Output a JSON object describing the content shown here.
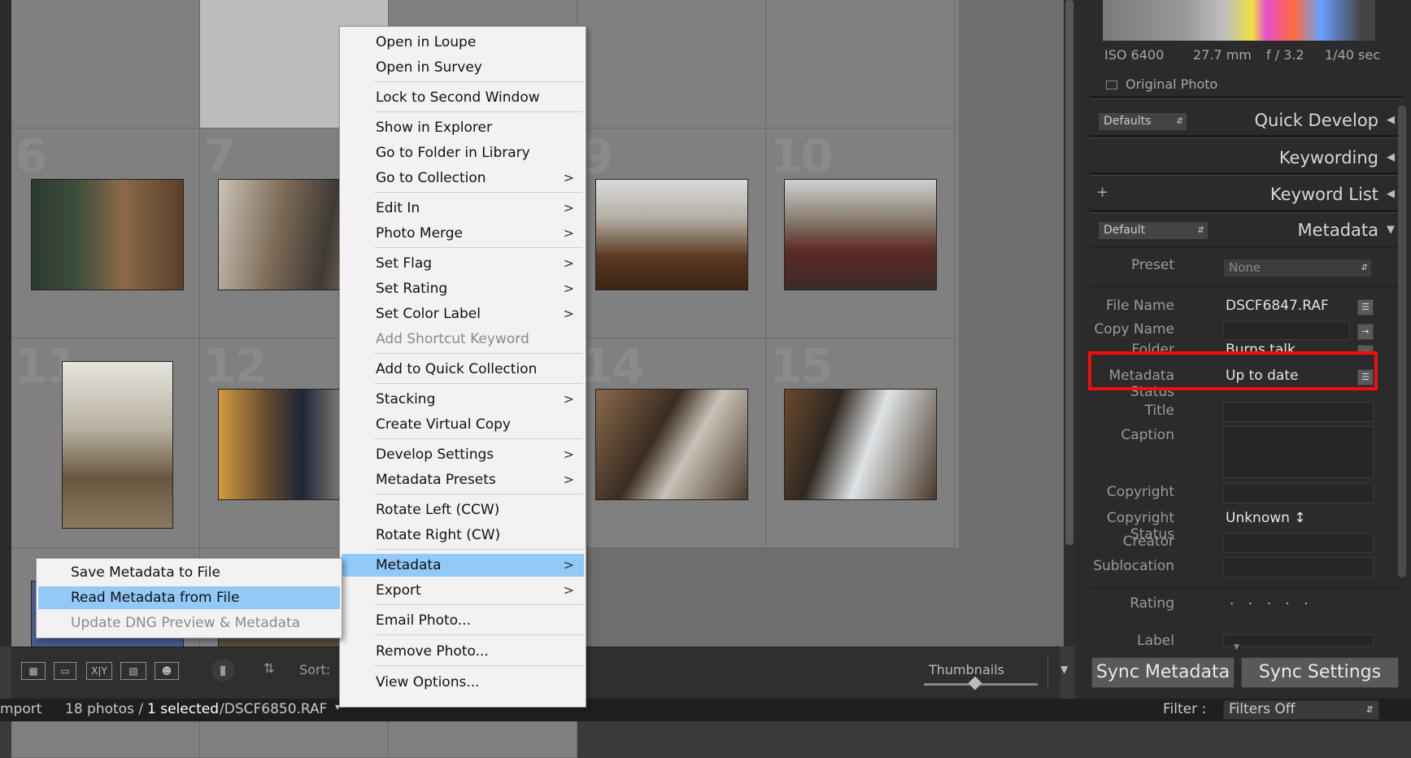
{
  "grid": {
    "cell_numbers": [
      "6",
      "7",
      "9",
      "10",
      "11",
      "12",
      "14",
      "15"
    ]
  },
  "toolbar": {
    "sort_label": "Sort:",
    "thumbnails_label": "Thumbnails",
    "thumbnail_size": 0.45
  },
  "status": {
    "left_text": "mport",
    "photos_text": "18 photos /",
    "selected_text": "1 selected",
    "file_text": "/DSCF6850.RAF",
    "filter_label": "Filter :",
    "filter_value": "Filters Off"
  },
  "histogram": {
    "iso": "ISO 6400",
    "focal": "27.7 mm",
    "aperture": "f / 3.2",
    "shutter": "1/40 sec",
    "original_photo": "Original Photo"
  },
  "panels": {
    "defaults_dropdown": "Defaults",
    "quick_develop": "Quick Develop",
    "keywording": "Keywording",
    "keyword_list": "Keyword List",
    "keyword_add": "+",
    "metadata_dropdown": "Default",
    "metadata": "Metadata"
  },
  "metadata": {
    "preset_label": "Preset",
    "preset_value": "None",
    "file_name_label": "File Name",
    "file_name_value": "DSCF6847.RAF",
    "copy_name_label": "Copy Name",
    "folder_label": "Folder",
    "folder_value": "Burns talk",
    "metadata_status_label": "Metadata Status",
    "metadata_status_value": "Up to date",
    "title_label": "Title",
    "caption_label": "Caption",
    "copyright_label": "Copyright",
    "copyright_status_label": "Copyright Status",
    "copyright_status_value": "Unknown ↕",
    "creator_label": "Creator",
    "sublocation_label": "Sublocation",
    "rating_label": "Rating",
    "rating_value": ". . . . .",
    "label_label": "Label"
  },
  "buttons": {
    "sync_metadata": "Sync Metadata",
    "sync_settings": "Sync Settings"
  },
  "context_menu": {
    "items": [
      {
        "label": "Open in Loupe"
      },
      {
        "label": "Open in Survey"
      },
      {
        "label": "Lock to Second Window"
      },
      {
        "label": "Show in Explorer"
      },
      {
        "label": "Go to Folder in Library"
      },
      {
        "label": "Go to Collection"
      },
      {
        "label": "Edit In"
      },
      {
        "label": "Photo Merge"
      },
      {
        "label": "Set Flag"
      },
      {
        "label": "Set Rating"
      },
      {
        "label": "Set Color Label"
      },
      {
        "label": "Add Shortcut Keyword"
      },
      {
        "label": "Add to Quick Collection"
      },
      {
        "label": "Stacking"
      },
      {
        "label": "Create Virtual Copy"
      },
      {
        "label": "Develop Settings"
      },
      {
        "label": "Metadata Presets"
      },
      {
        "label": "Rotate Left (CCW)"
      },
      {
        "label": "Rotate Right (CW)"
      },
      {
        "label": "Metadata"
      },
      {
        "label": "Export"
      },
      {
        "label": "Email Photo..."
      },
      {
        "label": "Remove Photo..."
      },
      {
        "label": "View Options..."
      }
    ],
    "submenu_arrow": ">"
  },
  "submenu": {
    "items": [
      {
        "label": "Save Metadata to File"
      },
      {
        "label": "Read Metadata from File"
      },
      {
        "label": "Update DNG Preview & Metadata"
      }
    ]
  },
  "colors": {
    "highlight": "#91c9f7",
    "annotation_red": "#f10d0d"
  }
}
